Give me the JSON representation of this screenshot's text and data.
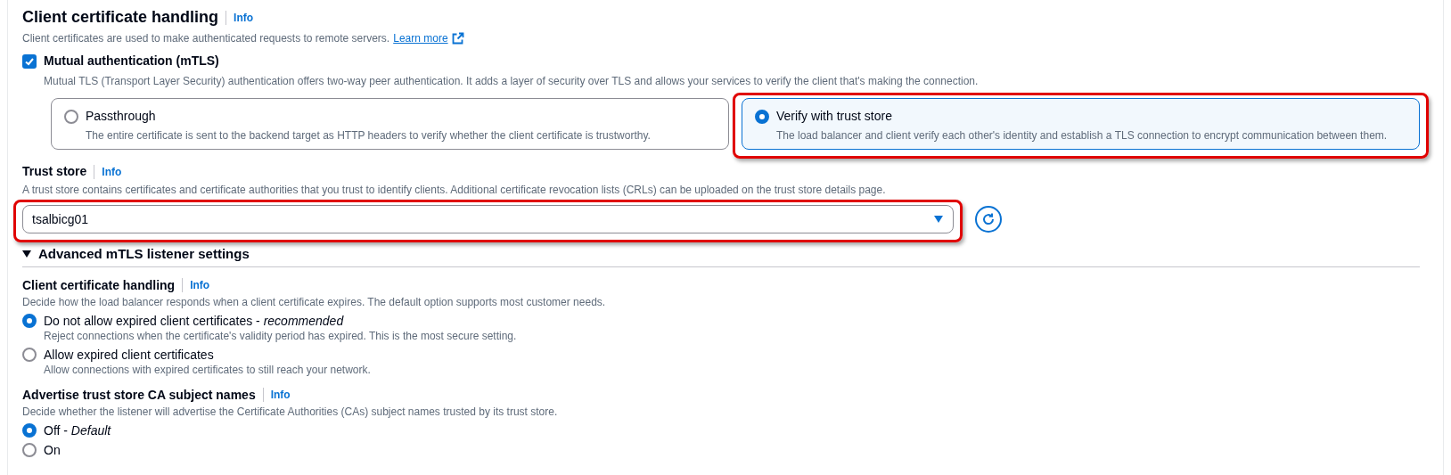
{
  "section": {
    "title": "Client certificate handling",
    "info": "Info",
    "description": "Client certificates are used to make authenticated requests to remote servers.",
    "learn_more": "Learn more"
  },
  "mtls": {
    "label": "Mutual authentication (mTLS)",
    "checked": true,
    "description": "Mutual TLS (Transport Layer Security) authentication offers two-way peer authentication. It adds a layer of security over TLS and allows your services to verify the client that's making the connection."
  },
  "mode_options": [
    {
      "label": "Passthrough",
      "description": "The entire certificate is sent to the backend target as HTTP headers to verify whether the client certificate is trustworthy.",
      "selected": false,
      "highlighted": false
    },
    {
      "label": "Verify with trust store",
      "description": "The load balancer and client verify each other's identity and establish a TLS connection to encrypt communication between them.",
      "selected": true,
      "highlighted": true
    }
  ],
  "trust_store": {
    "title": "Trust store",
    "info": "Info",
    "description": "A trust store contains certificates and certificate authorities that you trust to identify clients. Additional certificate revocation lists (CRLs) can be uploaded on the trust store details page.",
    "value": "tsalbicg01",
    "highlighted": true
  },
  "advanced": {
    "title": "Advanced mTLS listener settings",
    "expanded": true,
    "groups": [
      {
        "title": "Client certificate handling",
        "info": "Info",
        "description": "Decide how the load balancer responds when a client certificate expires. The default option supports most customer needs.",
        "options": [
          {
            "label": "Do not allow expired client certificates - *recommended*",
            "description": "Reject connections when the certificate's validity period has expired. This is the most secure setting.",
            "selected": true
          },
          {
            "label": "Allow expired client certificates",
            "description": "Allow connections with expired certificates to still reach your network.",
            "selected": false
          }
        ]
      },
      {
        "title": "Advertise trust store CA subject names",
        "info": "Info",
        "description": "Decide whether the listener will advertise the Certificate Authorities (CAs) subject names trusted by its trust store.",
        "options": [
          {
            "label": "Off - *Default*",
            "selected": true
          },
          {
            "label": "On",
            "selected": false
          }
        ]
      }
    ]
  }
}
